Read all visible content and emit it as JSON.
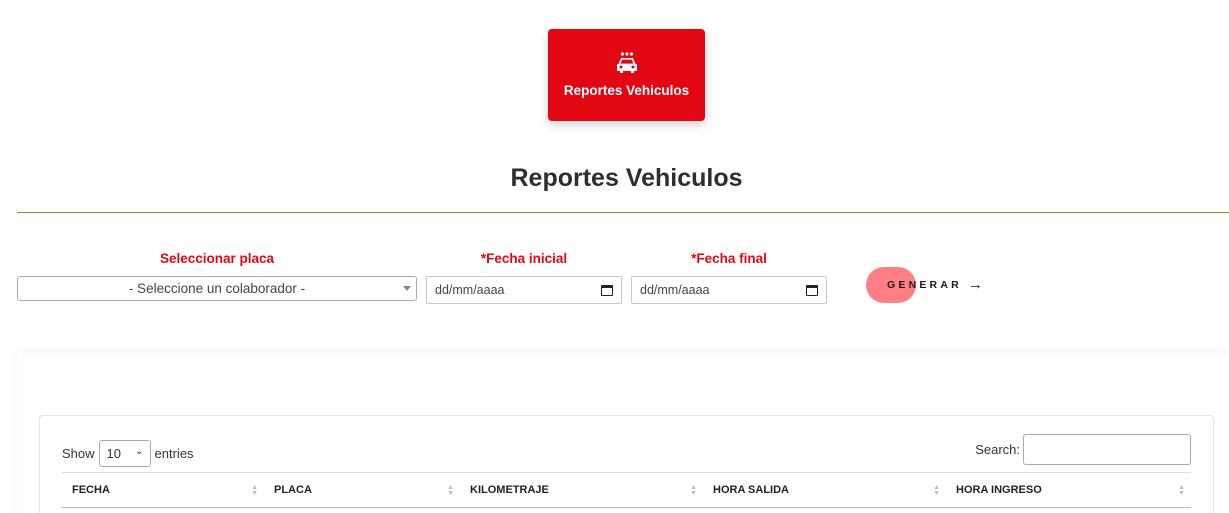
{
  "header_card": {
    "label": "Reportes Vehiculos",
    "icon": "car-icon",
    "bg_color": "#e30613"
  },
  "title": "Reportes Vehiculos",
  "filters": {
    "placa_label": "Seleccionar placa",
    "placa_value": "- Seleccione un colaborador -",
    "fecha_inicial_label": "*Fecha inicial",
    "fecha_inicial_value": "dd/mm/aaaa",
    "fecha_final_label": "*Fecha final",
    "fecha_final_value": "dd/mm/aaaa",
    "label_color": "#e30613"
  },
  "generate_button": {
    "label": "GENERAR",
    "icon": "arrow-right-icon",
    "accent": "#ff7f85"
  },
  "table_controls": {
    "show_label": "Show",
    "entries_value": "10",
    "entries_label": "entries",
    "search_label": "Search:"
  },
  "table": {
    "columns": [
      "FECHA",
      "PLACA",
      "KILOMETRAJE",
      "HORA SALIDA",
      "HORA INGRESO"
    ]
  }
}
